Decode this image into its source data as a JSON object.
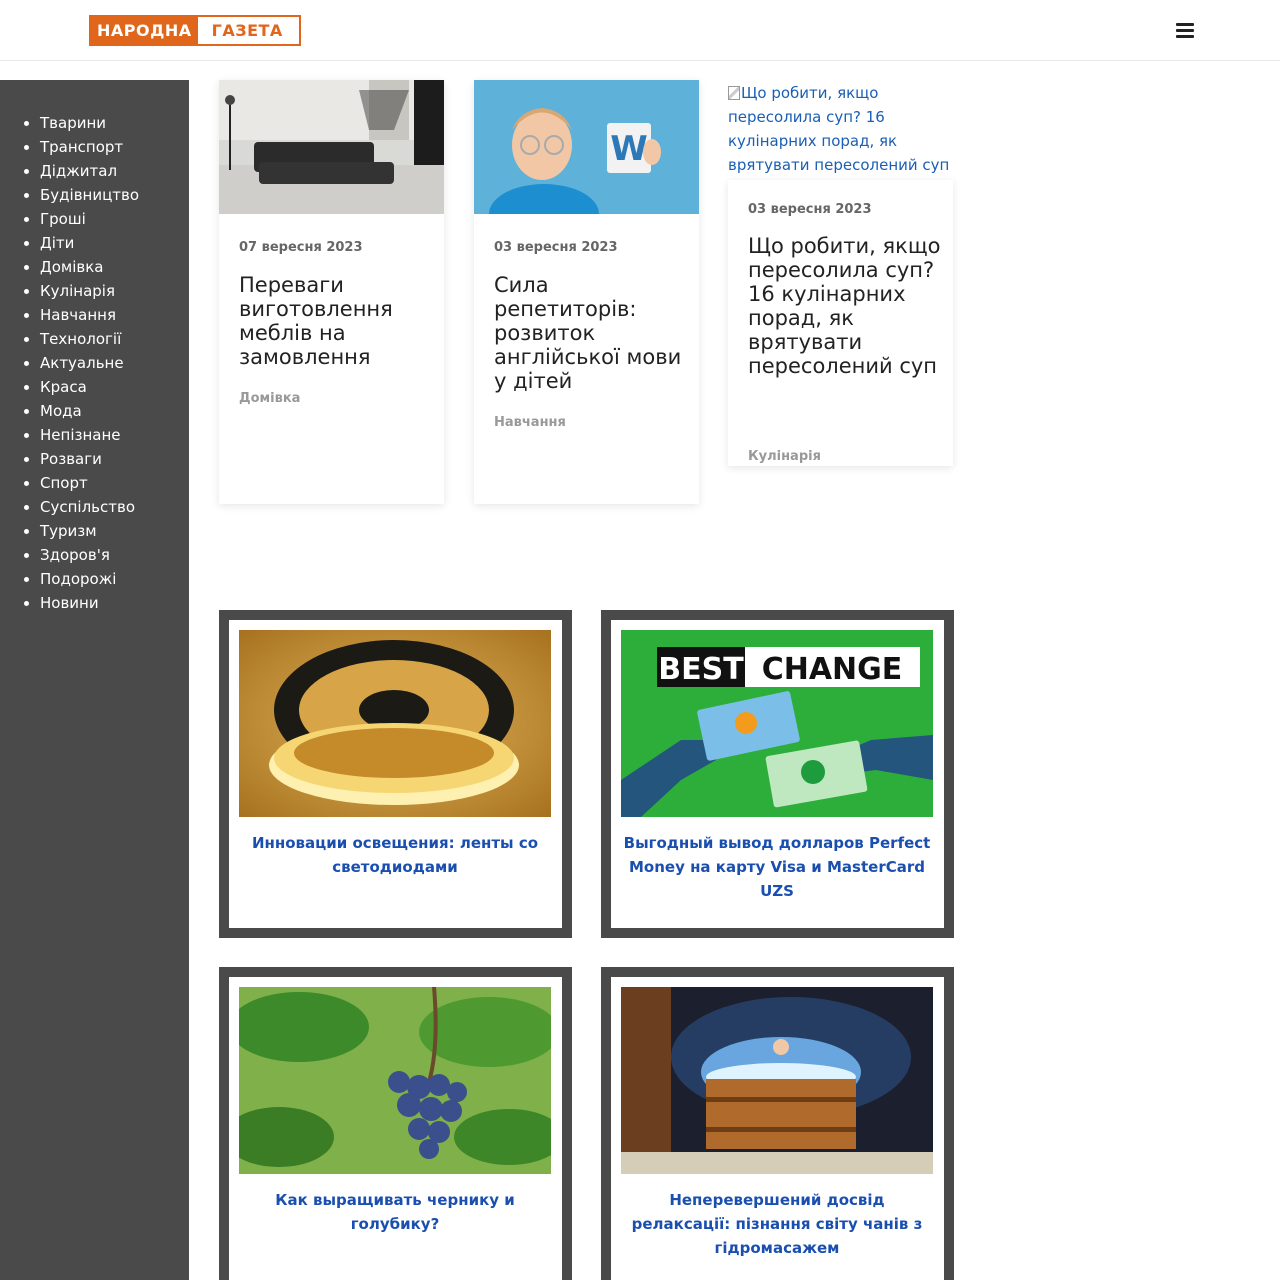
{
  "header": {
    "logo_part1": "НАРОДНА",
    "logo_part2": "ГАЗЕТА",
    "menu_icon": "hamburger-icon"
  },
  "sidebar": {
    "items": [
      {
        "label": "Тварини"
      },
      {
        "label": "Транспорт"
      },
      {
        "label": "Діджитал"
      },
      {
        "label": "Будівництво"
      },
      {
        "label": "Гроші"
      },
      {
        "label": "Діти"
      },
      {
        "label": "Домівка"
      },
      {
        "label": "Кулінарія"
      },
      {
        "label": "Навчання"
      },
      {
        "label": "Технології"
      },
      {
        "label": "Актуальне"
      },
      {
        "label": "Краса"
      },
      {
        "label": "Мода"
      },
      {
        "label": "Непізнане"
      },
      {
        "label": "Розваги"
      },
      {
        "label": "Спорт"
      },
      {
        "label": "Суспільство"
      },
      {
        "label": "Туризм"
      },
      {
        "label": "Здоров'я"
      },
      {
        "label": "Подорожі"
      },
      {
        "label": "Новини"
      }
    ]
  },
  "articles": [
    {
      "date": "07 вересня 2023",
      "title": "Переваги виготовлення меблів на замовлення",
      "category": "Домівка",
      "image": "sofa-interior-photo"
    },
    {
      "date": "03 вересня 2023",
      "title": "Сила репетиторів: розвиток англійської мови у дітей",
      "category": "Навчання",
      "image": "boy-with-letter-card-photo"
    },
    {
      "date": "03 вересня 2023",
      "title": "Що робити, якщо пересолила суп? 16 кулінарних порад, як врятувати пересолений суп",
      "category": "Кулінарія",
      "image_alt": "Що робити, якщо пересолила суп? 16 кулінарних порад, як врятувати пересолений суп"
    }
  ],
  "promos": [
    {
      "title": "Инновации освещения: ленты со светодиодами",
      "image": "led-strip-reel-photo"
    },
    {
      "title": "Выгодный вывод долларов Perfect Money на карту Visa и MasterCard UZS",
      "image": "bestchange-banner",
      "banner_words": [
        "BEST",
        "CHANGE"
      ]
    },
    {
      "title": "Как выращивать чернику и голубику?",
      "image": "blueberries-photo"
    },
    {
      "title": "Неперевершений досвід релаксації: пізнання світу чанів з гідромасажем",
      "image": "hot-tub-photo"
    }
  ]
}
